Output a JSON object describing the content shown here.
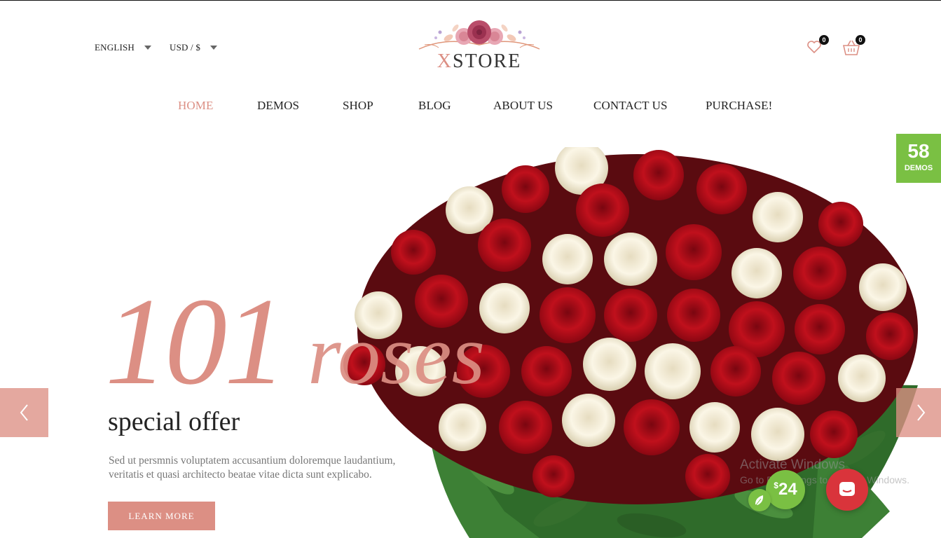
{
  "header": {
    "language": "ENGLISH",
    "currency": "USD / $",
    "logo_text_accent": "X",
    "logo_text_rest": "STORE",
    "wishlist_count": "0",
    "cart_count": "0"
  },
  "nav": {
    "items": [
      {
        "label": "HOME",
        "active": true
      },
      {
        "label": "DEMOS"
      },
      {
        "label": "SHOP"
      },
      {
        "label": "BLOG"
      },
      {
        "label": "ABOUT US"
      },
      {
        "label": "CONTACT US"
      },
      {
        "label": "PURCHASE!"
      }
    ]
  },
  "demos_badge": {
    "number": "58",
    "label": "DEMOS"
  },
  "hero": {
    "title_number": "101",
    "title_word": "roses",
    "subtitle": "special offer",
    "description_line1": "Sed ut persmnis voluptatem accusantium doloremque laudantium,",
    "description_line2": "veritatis et quasi architecto beatae vitae dicta sunt explicabo.",
    "button_label": "LEARN MORE"
  },
  "watermark": {
    "line1": "Activate Windows",
    "line2": "Go to PC settings to activate Windows."
  },
  "price_badge": {
    "currency": "$",
    "amount": "24"
  },
  "colors": {
    "accent": "#dc8f84",
    "green": "#7ac043",
    "chat": "#d9343b"
  },
  "icons": [
    "chevron-down-icon",
    "heart-icon",
    "basket-icon",
    "arrow-left-icon",
    "arrow-right-icon",
    "leaf-icon",
    "chat-icon"
  ]
}
